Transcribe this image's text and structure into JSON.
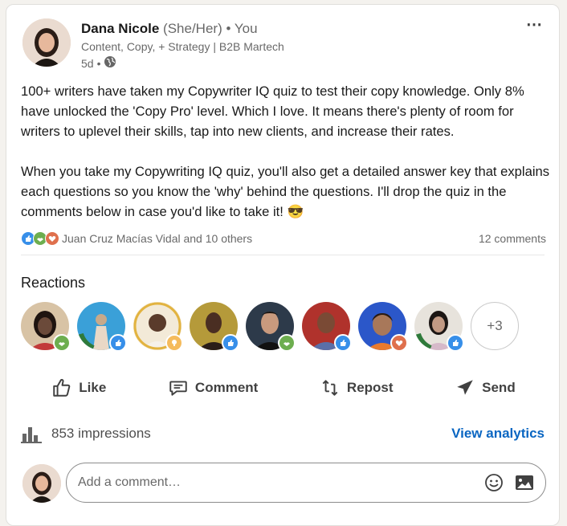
{
  "post": {
    "author": {
      "name": "Dana Nicole",
      "pronouns": "(She/Her)",
      "relation": "• You",
      "headline": "Content, Copy, + Strategy | B2B Martech",
      "time": "5d",
      "visibility_sep": "•",
      "visibility_icon": "globe-icon"
    },
    "more_icon": "⋯",
    "body": [
      "100+ writers have taken my Copywriter IQ quiz to test their copy knowledge. Only 8% have unlocked the 'Copy Pro' level. Which I love. It means there's plenty of room for writers to uplevel their skills, tap into new clients, and increase their rates.",
      "When you take my Copywriting IQ quiz, you'll also get a detailed answer key that explains each questions so you know the 'why' behind the questions. I'll drop the quiz in the comments below in case you'd like to take it! 😎"
    ],
    "social": {
      "reactors_text": "Juan Cruz Macías Vidal and 10 others",
      "comments_text": "12 comments",
      "reaction_icons": [
        "like-icon",
        "support-icon",
        "love-icon"
      ]
    }
  },
  "reactions": {
    "heading": "Reactions",
    "more": "+3",
    "people": [
      {
        "badge": "support",
        "face": "#6b4a3a"
      },
      {
        "badge": "like",
        "face": "#c7a98a"
      },
      {
        "badge": "insightful",
        "face": "#5a3b2b"
      },
      {
        "badge": "like",
        "face": "#4a2e22"
      },
      {
        "badge": "support",
        "face": "#3c3a38"
      },
      {
        "badge": "like",
        "face": "#7a4a35"
      },
      {
        "badge": "love",
        "face": "#a8785a"
      },
      {
        "badge": "like",
        "face": "#c29a84"
      }
    ]
  },
  "actions": {
    "like": "Like",
    "comment": "Comment",
    "repost": "Repost",
    "send": "Send"
  },
  "analytics": {
    "impressions": "853 impressions",
    "view": "View analytics"
  },
  "comment": {
    "placeholder": "Add a comment…"
  },
  "colors": {
    "link": "#0a66c2",
    "like": "#378fe9",
    "support": "#6dae4f",
    "love": "#df704d",
    "insightful": "#f5bb5c"
  }
}
